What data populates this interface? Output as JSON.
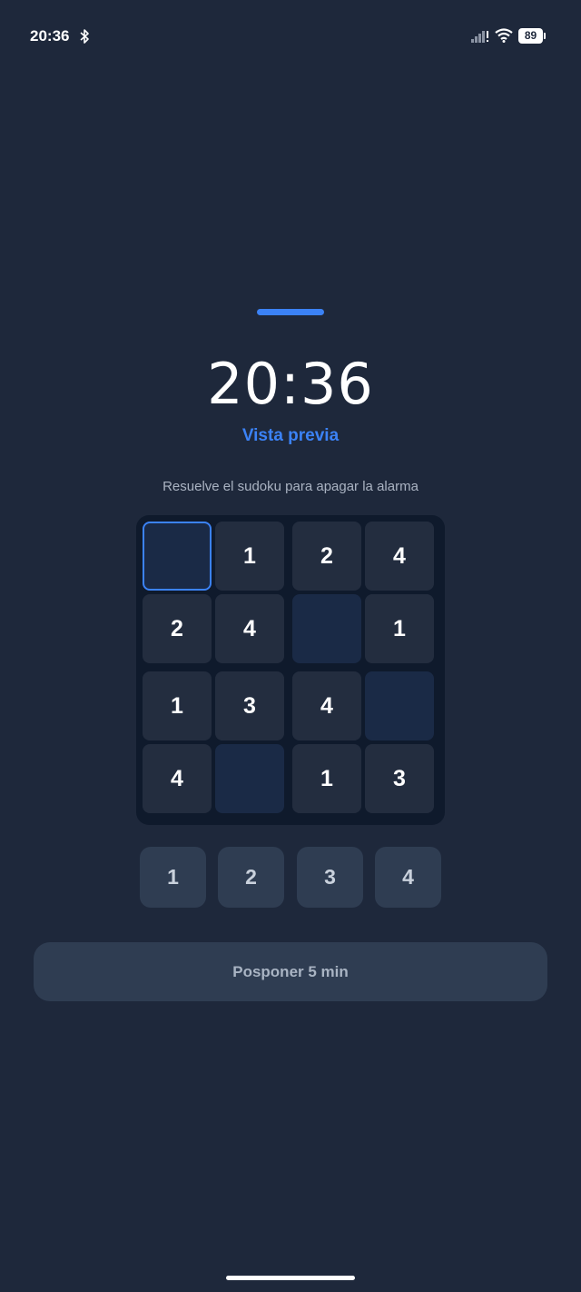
{
  "status_bar": {
    "time": "20:36",
    "battery": "89",
    "icons": [
      "bluetooth-icon",
      "signal-icon",
      "wifi-icon",
      "battery-icon"
    ]
  },
  "alarm": {
    "time": "20:36",
    "mode_label": "Vista previa",
    "instruction": "Resuelve el sudoku para apagar la alarma"
  },
  "sudoku": {
    "rows": [
      [
        "",
        "1",
        "2",
        "4"
      ],
      [
        "2",
        "4",
        "",
        "1"
      ],
      [
        "1",
        "3",
        "4",
        ""
      ],
      [
        "4",
        "",
        "1",
        "3"
      ]
    ],
    "selected": [
      0,
      0
    ]
  },
  "number_pad": [
    "1",
    "2",
    "3",
    "4"
  ],
  "snooze_label": "Posponer 5 min",
  "colors": {
    "background": "#1e283b",
    "accent": "#3b82f6",
    "board": "#0f1a2c",
    "button": "#2f3d52"
  }
}
